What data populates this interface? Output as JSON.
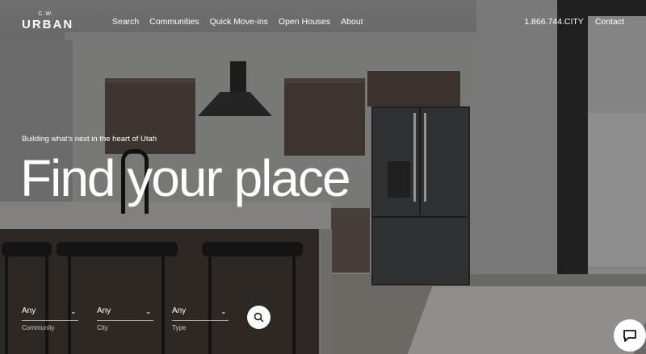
{
  "brand": {
    "small": "C.W.",
    "main": "URBAN"
  },
  "nav": {
    "items": [
      "Search",
      "Communities",
      "Quick Move-ins",
      "Open Houses",
      "About"
    ],
    "phone": "1.866.744.CITY",
    "contact": "Contact"
  },
  "hero": {
    "tagline": "Building what's next in the heart of Utah",
    "headline": "Find your place"
  },
  "filters": [
    {
      "value": "Any",
      "label": "Community"
    },
    {
      "value": "Any",
      "label": "City"
    },
    {
      "value": "Any",
      "label": "Type"
    }
  ],
  "icons": {
    "search": "search-icon",
    "chat": "chat-icon",
    "chevron": "chevron-down-icon"
  }
}
